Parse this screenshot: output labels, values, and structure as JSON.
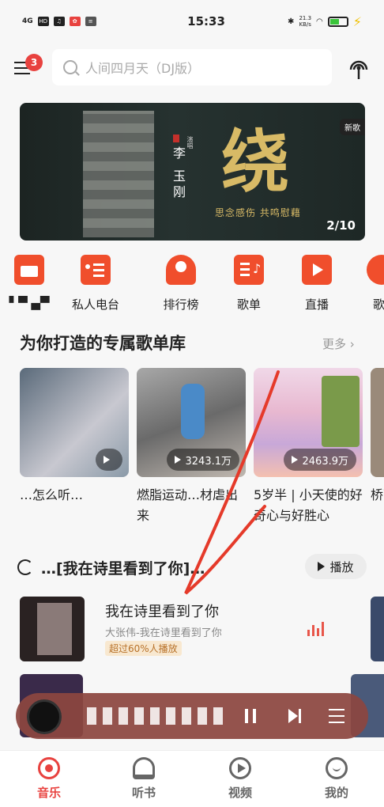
{
  "status_bar": {
    "signal": "4G",
    "hd": "HD",
    "time": "15:33",
    "net_speed": "21.3",
    "net_unit": "KB/s"
  },
  "search": {
    "placeholder": "人间四月天（DJ版）"
  },
  "menu_badge": "3",
  "banner": {
    "artist": "李 玉刚",
    "role": "演唱",
    "song_char": "绕",
    "subtitle": "思念感伤  共鸣慰藉",
    "tag": "新歌",
    "pager": "2/10"
  },
  "categories": [
    {
      "label": "",
      "icon": "calendar-icon"
    },
    {
      "label": "私人电台",
      "icon": "radio-icon"
    },
    {
      "label": "排行榜",
      "icon": "trophy-icon"
    },
    {
      "label": "歌单",
      "icon": "playlist-icon"
    },
    {
      "label": "直播",
      "icon": "video-icon"
    },
    {
      "label": "歌",
      "icon": "user-icon"
    }
  ],
  "section": {
    "title": "为你打造的专属歌单库",
    "more": "更多"
  },
  "playlists": [
    {
      "title": "…怎么听…",
      "count": ""
    },
    {
      "title": "燃脂运动…材虐出来",
      "count": "3243.1万"
    },
    {
      "title": "5岁半 | 小天使的好奇心与好胜心",
      "count": "2463.9万"
    },
    {
      "title": "桥下",
      "count": ""
    }
  ],
  "daily": {
    "title": "…[我在诗里看到了你]…",
    "play_all": "播放"
  },
  "song": {
    "title": "我在诗里看到了你",
    "artist": "大张伟-我在诗里看到了你",
    "tag": "超过60%人播放"
  },
  "tabs": [
    {
      "label": "音乐",
      "icon": "music-icon",
      "active": true
    },
    {
      "label": "听书",
      "icon": "headphones-icon",
      "active": false
    },
    {
      "label": "视频",
      "icon": "video-play-icon",
      "active": false
    },
    {
      "label": "我的",
      "icon": "profile-icon",
      "active": false
    }
  ],
  "colors": {
    "accent": "#e8423f",
    "icon_orange": "#f04e2c",
    "player_bg": "#8c4640"
  }
}
